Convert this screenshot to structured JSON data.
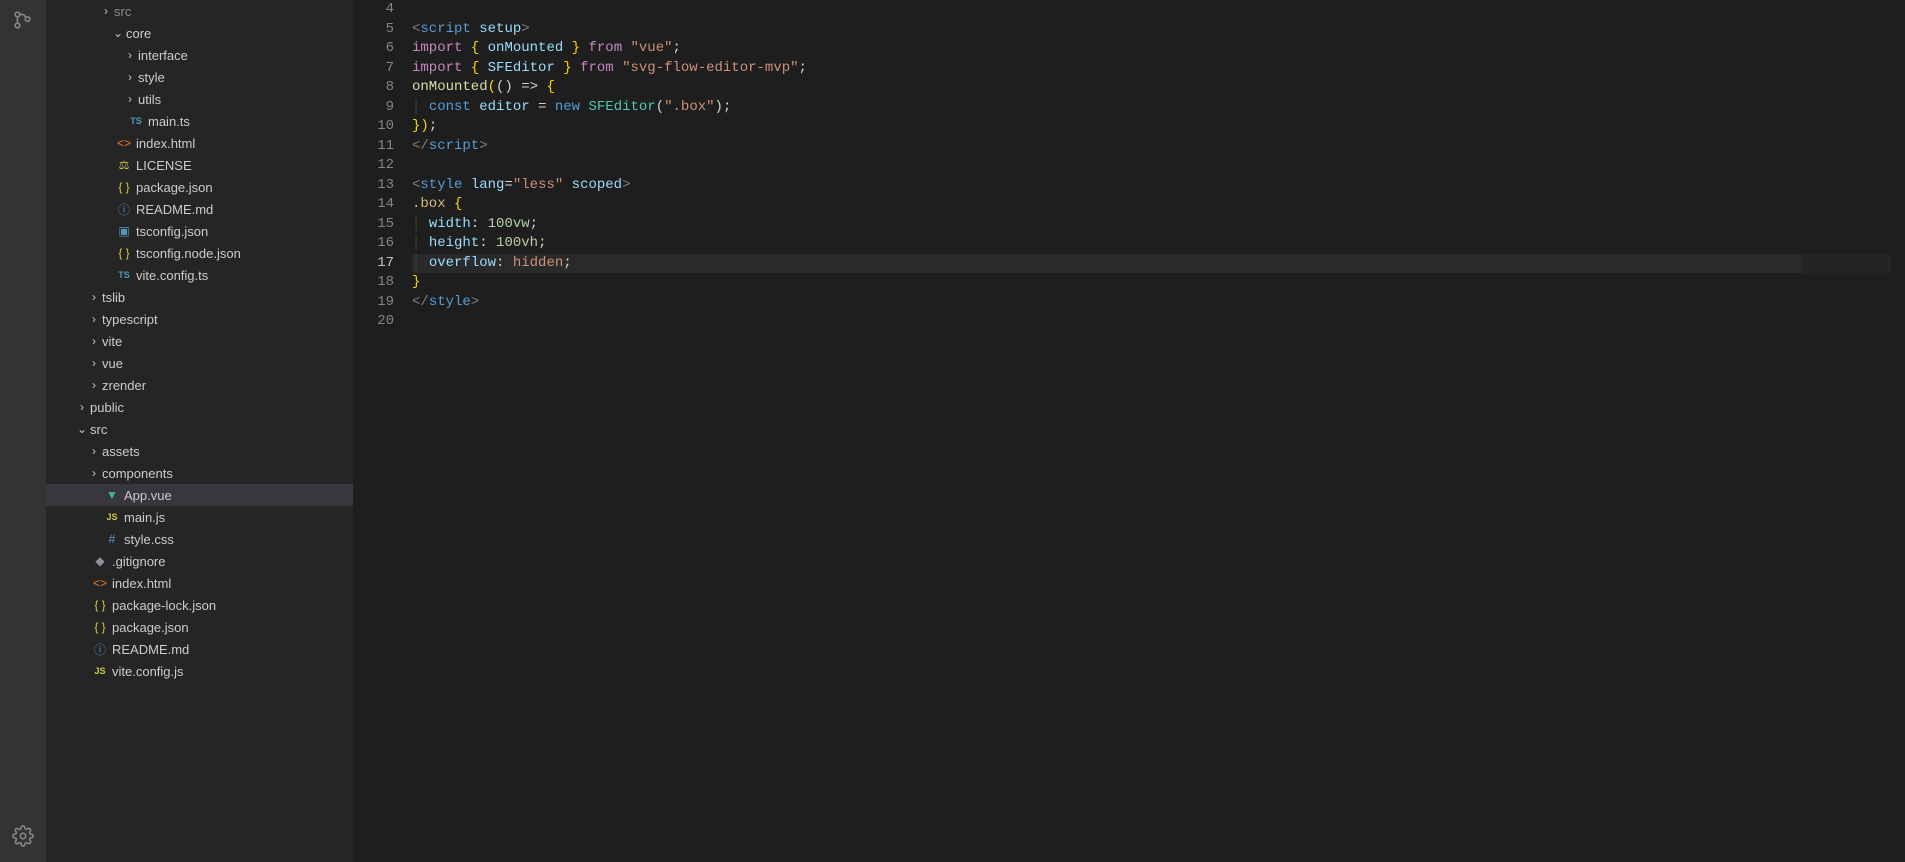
{
  "tree": [
    {
      "indent": 4,
      "chev": "right",
      "icon": "",
      "label": "src",
      "dim": true
    },
    {
      "indent": 5,
      "chev": "down",
      "icon": "",
      "label": "core"
    },
    {
      "indent": 6,
      "chev": "right",
      "icon": "",
      "label": "interface"
    },
    {
      "indent": 6,
      "chev": "right",
      "icon": "",
      "label": "style"
    },
    {
      "indent": 6,
      "chev": "right",
      "icon": "",
      "label": "utils"
    },
    {
      "indent": 5,
      "chev": "",
      "icon": "ts",
      "label": "main.ts"
    },
    {
      "indent": 4,
      "chev": "",
      "icon": "html",
      "label": "index.html"
    },
    {
      "indent": 4,
      "chev": "",
      "icon": "license",
      "label": "LICENSE"
    },
    {
      "indent": 4,
      "chev": "",
      "icon": "json",
      "label": "package.json"
    },
    {
      "indent": 4,
      "chev": "",
      "icon": "info",
      "label": "README.md"
    },
    {
      "indent": 4,
      "chev": "",
      "icon": "tsconfig",
      "label": "tsconfig.json"
    },
    {
      "indent": 4,
      "chev": "",
      "icon": "json",
      "label": "tsconfig.node.json"
    },
    {
      "indent": 4,
      "chev": "",
      "icon": "ts",
      "label": "vite.config.ts"
    },
    {
      "indent": 3,
      "chev": "right",
      "icon": "",
      "label": "tslib"
    },
    {
      "indent": 3,
      "chev": "right",
      "icon": "",
      "label": "typescript"
    },
    {
      "indent": 3,
      "chev": "right",
      "icon": "",
      "label": "vite"
    },
    {
      "indent": 3,
      "chev": "right",
      "icon": "",
      "label": "vue"
    },
    {
      "indent": 3,
      "chev": "right",
      "icon": "",
      "label": "zrender"
    },
    {
      "indent": 2,
      "chev": "right",
      "icon": "",
      "label": "public"
    },
    {
      "indent": 2,
      "chev": "down",
      "icon": "",
      "label": "src"
    },
    {
      "indent": 3,
      "chev": "right",
      "icon": "",
      "label": "assets"
    },
    {
      "indent": 3,
      "chev": "right",
      "icon": "",
      "label": "components"
    },
    {
      "indent": 3,
      "chev": "",
      "icon": "vue",
      "label": "App.vue",
      "selected": true
    },
    {
      "indent": 3,
      "chev": "",
      "icon": "js",
      "label": "main.js"
    },
    {
      "indent": 3,
      "chev": "",
      "icon": "css",
      "label": "style.css"
    },
    {
      "indent": 2,
      "chev": "",
      "icon": "git",
      "label": ".gitignore"
    },
    {
      "indent": 2,
      "chev": "",
      "icon": "html",
      "label": "index.html"
    },
    {
      "indent": 2,
      "chev": "",
      "icon": "json",
      "label": "package-lock.json"
    },
    {
      "indent": 2,
      "chev": "",
      "icon": "json",
      "label": "package.json"
    },
    {
      "indent": 2,
      "chev": "",
      "icon": "info",
      "label": "README.md"
    },
    {
      "indent": 2,
      "chev": "",
      "icon": "js",
      "label": "vite.config.js"
    }
  ],
  "lineNumbers": [
    "4",
    "5",
    "6",
    "7",
    "8",
    "9",
    "10",
    "11",
    "12",
    "13",
    "14",
    "15",
    "16",
    "17",
    "18",
    "19",
    "20"
  ],
  "currentLine": "17",
  "code": {
    "l5": {
      "a": "script",
      "b": "setup"
    },
    "l6": {
      "a": "import",
      "b": "onMounted",
      "c": "from",
      "d": "\"vue\""
    },
    "l7": {
      "a": "import",
      "b": "SFEditor",
      "c": "from",
      "d": "\"svg-flow-editor-mvp\""
    },
    "l8": {
      "a": "onMounted"
    },
    "l9": {
      "a": "const",
      "b": "editor",
      "c": "new",
      "d": "SFEditor",
      "e": "\".box\""
    },
    "l11": {
      "a": "script"
    },
    "l13": {
      "a": "style",
      "b": "lang",
      "c": "\"less\"",
      "d": "scoped"
    },
    "l14": {
      "a": ".box"
    },
    "l15": {
      "a": "width",
      "b": "100vw"
    },
    "l16": {
      "a": "height",
      "b": "100vh"
    },
    "l17": {
      "a": "overflow",
      "b": "hidden"
    },
    "l19": {
      "a": "style"
    }
  }
}
